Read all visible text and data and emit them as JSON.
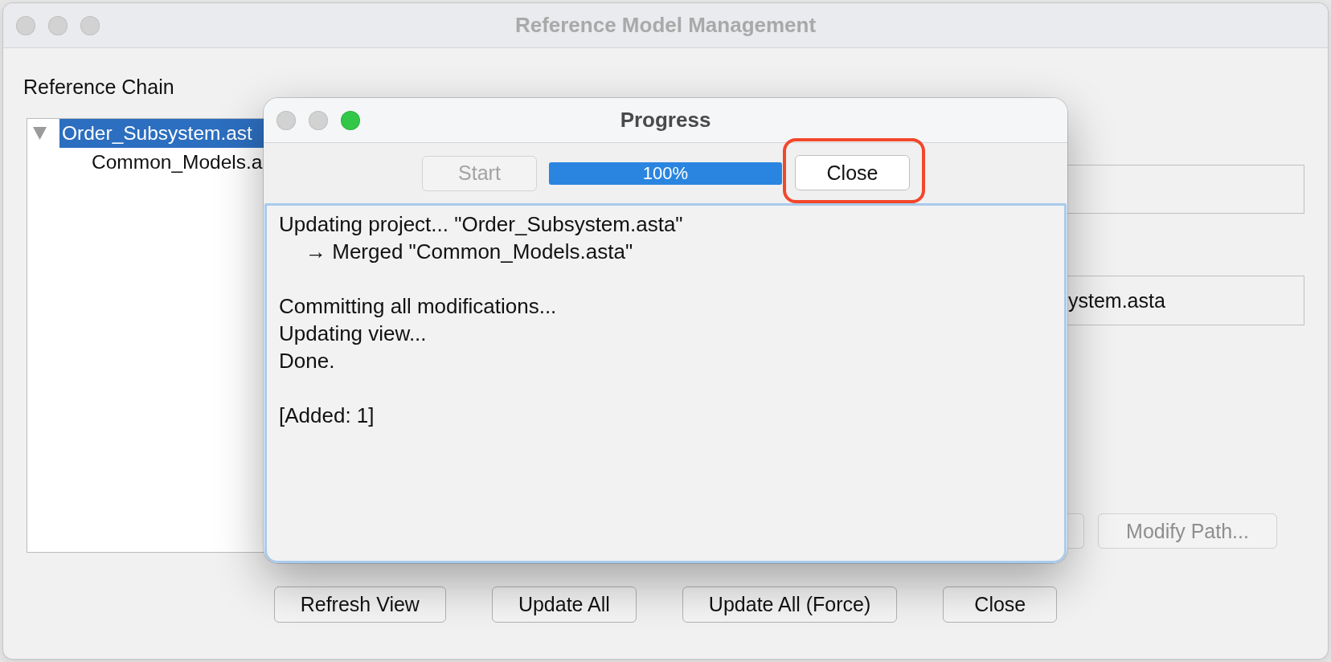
{
  "window": {
    "title": "Reference Model Management",
    "controls": [
      {
        "enabled": false
      },
      {
        "enabled": false
      },
      {
        "enabled": false
      }
    ]
  },
  "reference_chain": {
    "label": "Reference Chain",
    "tree": [
      {
        "label": "Order_Subsystem.ast",
        "selected": true,
        "expanded": true,
        "children": [
          {
            "label": "Common_Models.a",
            "selected": false
          }
        ]
      }
    ]
  },
  "fields": [
    {
      "kind": "text_field"
    },
    {
      "kind": "text_field",
      "value": "ystem.asta"
    }
  ],
  "side_buttons": [
    {
      "kind": "partial",
      "disabled": true
    },
    {
      "kind": "button",
      "label": "Modify Path...",
      "disabled": true
    }
  ],
  "buttons": [
    {
      "label": "Refresh View"
    },
    {
      "label": "Update All"
    },
    {
      "label": "Update All (Force)"
    },
    {
      "label": "Close"
    }
  ],
  "progress_dialog": {
    "title": "Progress",
    "controls": [
      {
        "enabled": false
      },
      {
        "enabled": false
      },
      {
        "enabled": true
      }
    ],
    "start_button": {
      "label": "Start",
      "disabled": true
    },
    "progress": {
      "level": 1,
      "reading": "100%"
    },
    "close_button": {
      "label": "Close",
      "disabled": false,
      "highlighted": true
    },
    "log": [
      [
        {
          "kind": "step",
          "text": "Updating project... \"Order_Subsystem.asta\""
        },
        {
          "kind": "detail",
          "text": "→ Merged \"Common_Models.asta\""
        }
      ],
      [
        {
          "kind": "step",
          "text": "Committing all modifications..."
        },
        {
          "kind": "step",
          "text": "Updating view..."
        },
        {
          "kind": "step",
          "text": "Done."
        }
      ],
      [
        {
          "kind": "step",
          "text": "[Added: 1]"
        }
      ]
    ]
  }
}
